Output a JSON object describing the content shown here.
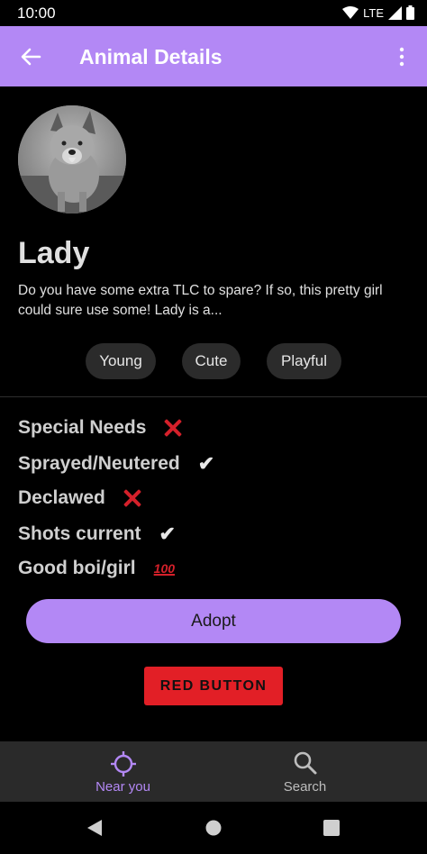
{
  "status_bar": {
    "time": "10:00",
    "network": "LTE",
    "icons": [
      "wifi-icon",
      "signal-icon",
      "battery-icon"
    ]
  },
  "app_bar": {
    "title": "Animal Details",
    "back_icon": "arrow-back-icon",
    "overflow_icon": "more-vert-icon",
    "color": "#b388f5"
  },
  "animal": {
    "name": "Lady",
    "description": "Do you have some extra TLC to spare? If so, this pretty girl could sure use some! Lady is a...",
    "photo": "dog-photo"
  },
  "tags": [
    "Young",
    "Cute",
    "Playful"
  ],
  "traits": [
    {
      "label": "Special Needs",
      "icon": "cross-mark-icon"
    },
    {
      "label": "Sprayed/Neutered",
      "icon": "check-mark-icon"
    },
    {
      "label": "Declawed",
      "icon": "cross-mark-icon"
    },
    {
      "label": "Shots current",
      "icon": "check-mark-icon"
    },
    {
      "label": "Good boi/girl",
      "icon": "hundred-points-icon"
    }
  ],
  "buttons": {
    "adopt_label": "Adopt",
    "red_label": "RED BUTTON",
    "adopt_color": "#b388f5",
    "red_color": "#e21f26"
  },
  "bottom_nav": {
    "items": [
      {
        "label": "Near you",
        "icon": "location-target-icon",
        "selected": true
      },
      {
        "label": "Search",
        "icon": "search-icon",
        "selected": false
      }
    ],
    "selected_color": "#b388f5"
  },
  "system_nav": {
    "icons": [
      "back-triangle-icon",
      "home-circle-icon",
      "recents-square-icon"
    ]
  }
}
